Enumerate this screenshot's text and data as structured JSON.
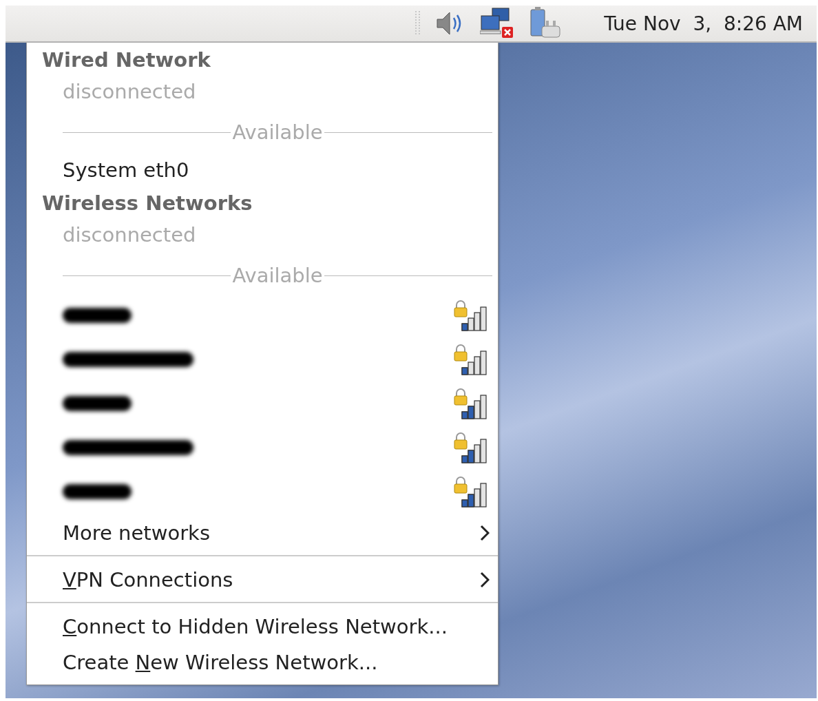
{
  "panel": {
    "clock": "Tue Nov  3,  8:26 AM"
  },
  "menu": {
    "sections": [
      {
        "title": "Wired Network",
        "status": "disconnected",
        "available_label": "Available",
        "items": [
          {
            "label": "System eth0"
          }
        ]
      },
      {
        "title": "Wireless Networks",
        "status": "disconnected",
        "available_label": "Available",
        "networks": [
          {
            "secured": true,
            "level": 0.25
          },
          {
            "secured": true,
            "level": 0.25
          },
          {
            "secured": true,
            "level": 0.5
          },
          {
            "secured": true,
            "level": 0.5
          },
          {
            "secured": true,
            "level": 0.5
          }
        ],
        "more": {
          "label": "More networks",
          "submenu": true
        }
      }
    ],
    "entries": [
      {
        "accel": "V",
        "post": "PN Connections",
        "submenu": true,
        "separator_before": true
      },
      {
        "accel": "C",
        "post": "onnect to Hidden Wireless Network...",
        "submenu": false,
        "separator_before": true
      },
      {
        "pre": "Create ",
        "accel": "N",
        "post": "ew Wireless Network...",
        "submenu": false,
        "separator_before": false
      }
    ]
  }
}
